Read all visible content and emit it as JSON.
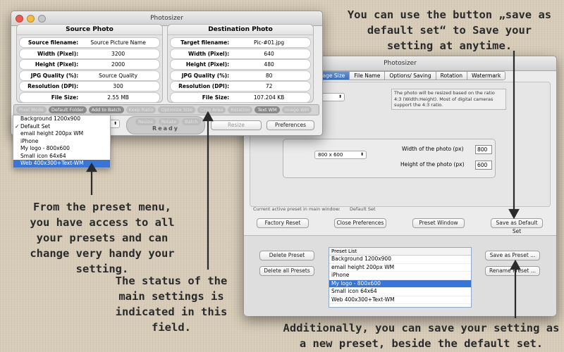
{
  "colors": {
    "background": "#d8ccb8",
    "selection": "#3875d7"
  },
  "main_window": {
    "title": "Photosizer",
    "source": {
      "header": "Source Photo",
      "rows": [
        {
          "label": "Source filename:",
          "value": "Source Picture Name"
        },
        {
          "label": "Width (Pixel):",
          "value": "3200"
        },
        {
          "label": "Height (Pixel):",
          "value": "2000"
        },
        {
          "label": "JPG Quality (%):",
          "value": "Source Quality"
        },
        {
          "label": "Resolution (DPI):",
          "value": "300"
        },
        {
          "label": "File Size:",
          "value": "2.55 MB"
        }
      ]
    },
    "destination": {
      "header": "Destination Photo",
      "rows": [
        {
          "label": "Target filename:",
          "value": "Pic-#01.jpg"
        },
        {
          "label": "Width (Pixel):",
          "value": "640"
        },
        {
          "label": "Height (Pixel):",
          "value": "480"
        },
        {
          "label": "JPG Quality (%):",
          "value": "80"
        },
        {
          "label": "Resolution (DPI):",
          "value": "72"
        },
        {
          "label": "File Size:",
          "value": "107.204 KB"
        }
      ]
    },
    "status_chips": [
      {
        "label": "Pixel Mode",
        "active": false
      },
      {
        "label": "Default Folder",
        "active": true
      },
      {
        "label": "Add to Batch",
        "active": true
      },
      {
        "label": "Keep Ratio",
        "active": false
      },
      {
        "label": "Optimize Size",
        "active": false
      },
      {
        "label": "Crop Area",
        "active": false
      },
      {
        "label": "Rotation",
        "active": false
      },
      {
        "label": "Text WM",
        "active": true
      },
      {
        "label": "Image WM",
        "active": false
      }
    ],
    "ready_label": "Ready",
    "small_buttons": [
      "Resize",
      "Rotate",
      "Batch"
    ],
    "resize_button": "Resize",
    "preferences_button": "Preferences",
    "preset_menu": {
      "items": [
        "Background 1200x900",
        "Default Set",
        "email height 200px WM",
        "iPhone",
        "My logo - 800x600",
        "Small icon 64x64",
        "Web 400x300+Text-WM"
      ],
      "checked": "Default Set",
      "selected": "Web 400x300+Text-WM"
    }
  },
  "pref_window": {
    "title": "Photosizer",
    "tabs": [
      "Image Size",
      "File Name",
      "Options/ Saving",
      "Rotation",
      "Watermark"
    ],
    "active_tab": "Image Size",
    "info_text": "The photo will be resized based on the ratio 4:3 (Width:Height). Most of digital cameras support the 4:3 ratio.",
    "size_select": "800 x 600",
    "width_label": "Width of the photo (px)",
    "width_value": "800",
    "height_label": "Height of the photo (px)",
    "height_value": "600",
    "current_preset_label": "Current active preset in main window:",
    "current_preset_value": "Default Set",
    "buttons": {
      "factory_reset": "Factory Reset",
      "close_preferences": "Close Preferences",
      "preset_window": "Preset Window",
      "save_default": "Save as Default Set"
    },
    "preset_list": {
      "header": "Preset List",
      "items": [
        "Background 1200x900",
        "email height 200px WM",
        "iPhone",
        "My logo - 800x600",
        "Small icon 64x64",
        "Web 400x300+Text-WM"
      ],
      "selected": "My logo - 800x600"
    },
    "delete_preset": "Delete Preset",
    "delete_all": "Delete all Presets",
    "save_as_preset": "Save as Preset ...",
    "rename_preset": "Rename Preset ..."
  },
  "annotations": {
    "top_right": "You can use the button „save as default set“ to Save your setting at anytime.",
    "left": "From the preset menu, you have access to all your presets and can change very handy your setting.",
    "middle": "The status of the main settings is indicated in this field.",
    "bottom": "Additionally, you can save your setting as a new preset, beside the default set."
  }
}
